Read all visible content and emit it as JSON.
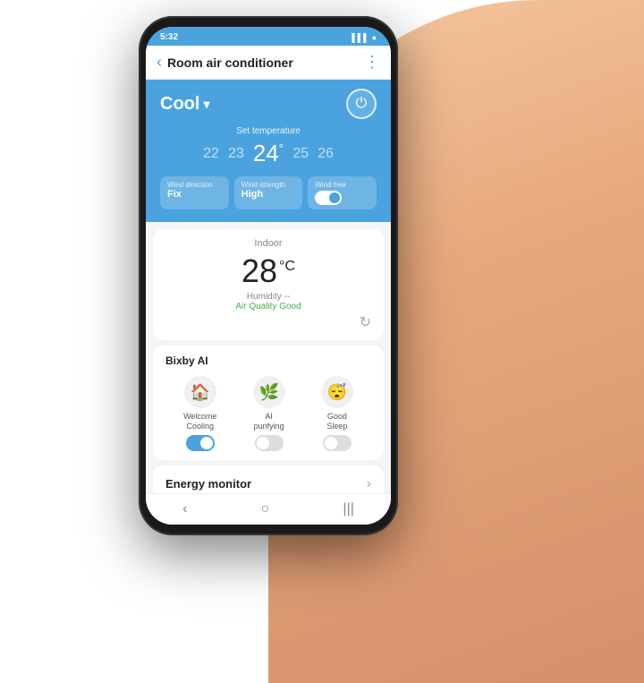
{
  "status_bar": {
    "time": "5:32",
    "icons": "▌▌▌ ● "
  },
  "header": {
    "title": "Room air conditioner",
    "back_icon": "‹",
    "menu_icon": "⋮"
  },
  "control_panel": {
    "mode": "Cool",
    "mode_arrow": "▾",
    "power_icon": "⏻",
    "temp_label": "Set temperature",
    "temperatures": [
      "22",
      "23",
      "24",
      "25",
      "26"
    ],
    "active_temp_index": 2,
    "degree_symbol": "°",
    "wind_direction_label": "Wind direction",
    "wind_direction_value": "Fix",
    "wind_strength_label": "Wind strength",
    "wind_strength_value": "High",
    "wind_free_label": "Wind free"
  },
  "indoor": {
    "title": "Indoor",
    "temperature": "28",
    "unit": "°C",
    "humidity": "Humidity --",
    "air_quality_label": "Air Quality",
    "air_quality_value": "Good",
    "refresh_icon": "↻"
  },
  "bixby": {
    "title": "Bixby AI",
    "items": [
      {
        "label": "Welcome\nCooling",
        "toggle": "on",
        "icon": "🏠"
      },
      {
        "label": "AI\npurifying",
        "toggle": "off",
        "icon": "🌿"
      },
      {
        "label": "Good\nSleep",
        "toggle": "off",
        "icon": "😴"
      }
    ]
  },
  "energy_monitor": {
    "label": "Energy monitor",
    "arrow": "›"
  },
  "bottom_nav": {
    "back": "‹",
    "home": "○",
    "recent": "|||"
  }
}
